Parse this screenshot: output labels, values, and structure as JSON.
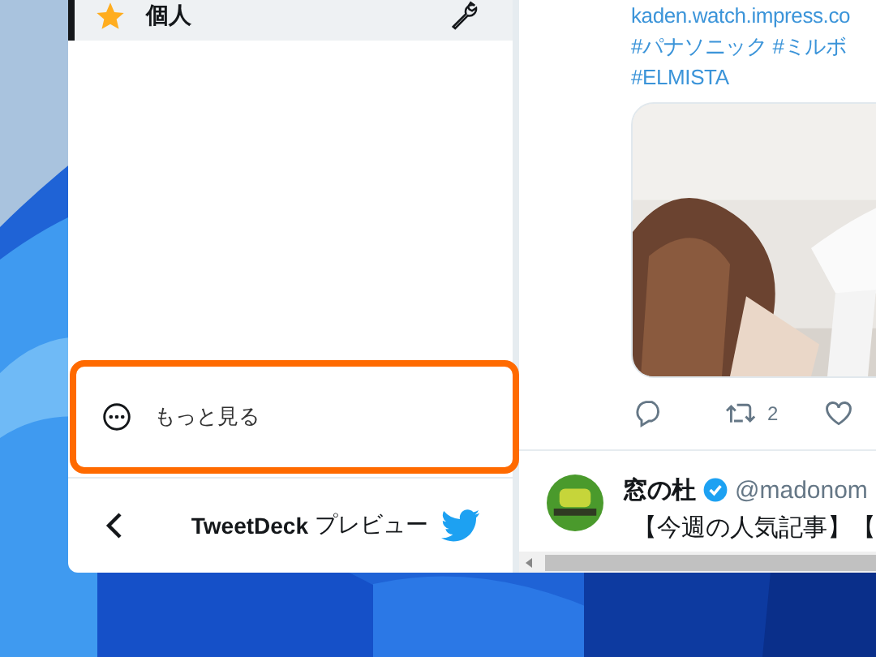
{
  "sidebar": {
    "items": [
      {
        "label": "個人",
        "selected": true
      }
    ],
    "more_button": {
      "label": "もっと見る",
      "highlighted": true
    },
    "footer": {
      "brand": "TweetDeck",
      "label": "プレビュー"
    }
  },
  "column": {
    "tweets": [
      {
        "kind": "media",
        "lines": [
          "kaden.watch.impress.co",
          "#パナソニック #ミルボ",
          "#ELMISTA"
        ],
        "retweets": "2"
      },
      {
        "kind": "text",
        "name": "窓の杜",
        "verified": true,
        "handle": "@madonom",
        "text": "【今週の人気記事】【"
      }
    ]
  }
}
